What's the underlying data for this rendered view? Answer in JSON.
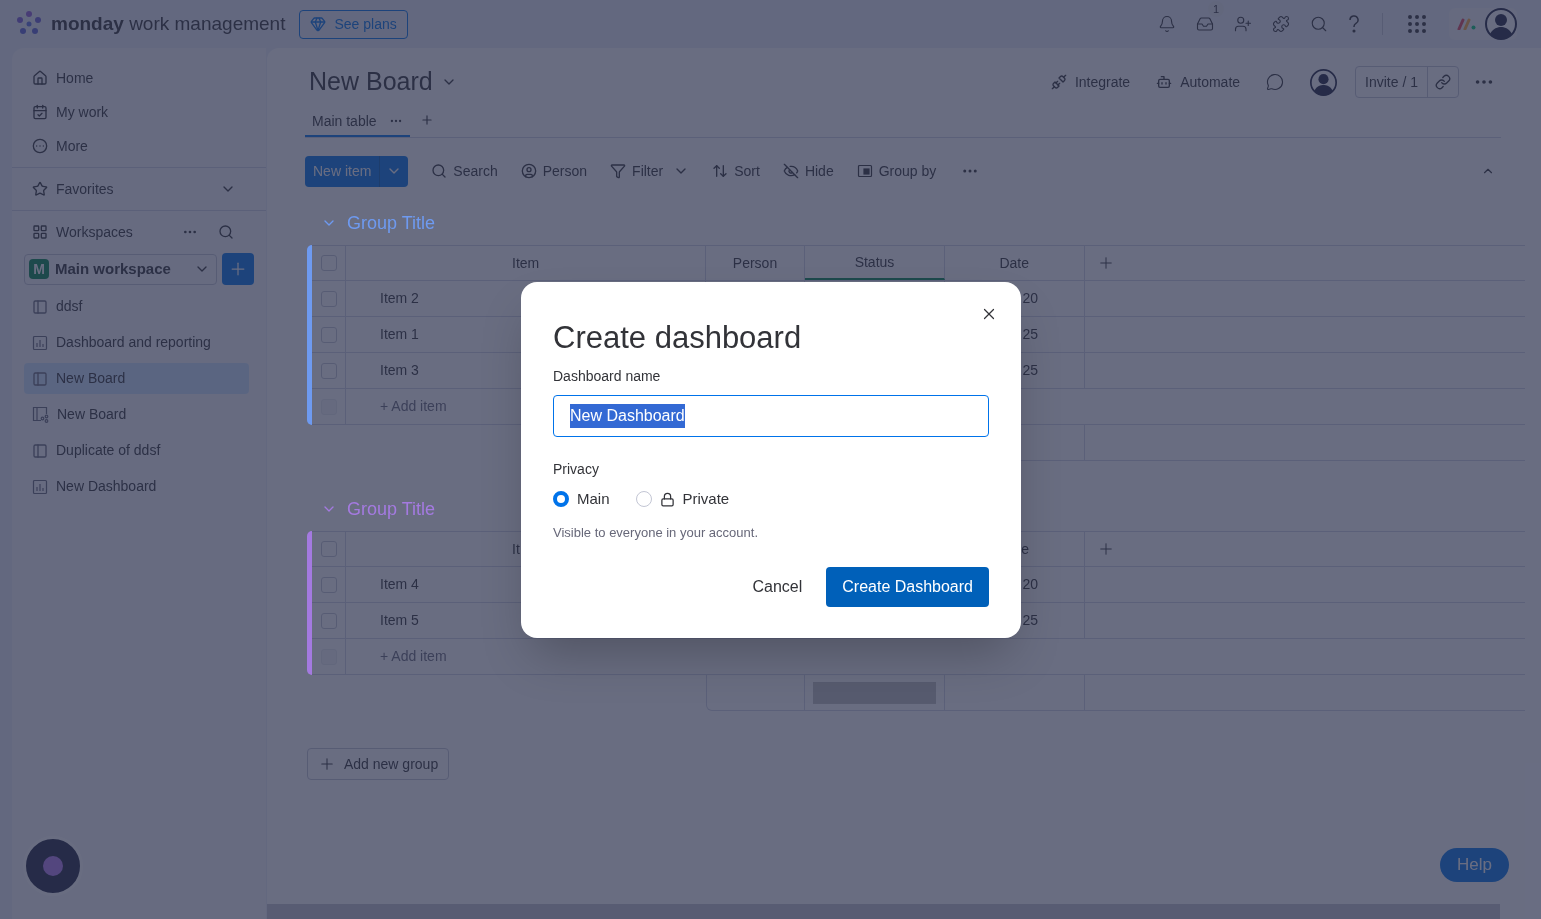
{
  "top_bar": {
    "brand": "monday",
    "product": "work management",
    "plans_button": "See plans",
    "inbox_badge": "1"
  },
  "sidebar": {
    "nav": [
      {
        "kind": "home",
        "label": "Home"
      },
      {
        "kind": "my_work",
        "label": "My work"
      },
      {
        "kind": "more",
        "label": "More"
      }
    ],
    "favorites": "Favorites",
    "workspaces_label": "Workspaces",
    "workspace": {
      "initial": "M",
      "name": "Main workspace"
    },
    "items": [
      {
        "kind": "board",
        "label": "ddsf",
        "selected": false
      },
      {
        "kind": "dashboard",
        "label": "Dashboard and reporting",
        "selected": false
      },
      {
        "kind": "board",
        "label": "New Board",
        "selected": true
      },
      {
        "kind": "shared_board",
        "label": "New Board",
        "selected": false
      },
      {
        "kind": "board",
        "label": "Duplicate of ddsf",
        "selected": false
      },
      {
        "kind": "dashboard",
        "label": "New Dashboard",
        "selected": false
      }
    ]
  },
  "board": {
    "title": "New Board",
    "header_actions": [
      {
        "kind": "integrate",
        "label": "Integrate"
      },
      {
        "kind": "automate",
        "label": "Automate"
      }
    ],
    "invite": "Invite / 1",
    "views": [
      {
        "label": "Main table",
        "selected": true
      }
    ],
    "new_item": "New item",
    "tools": [
      {
        "kind": "search",
        "label": "Search"
      },
      {
        "kind": "person",
        "label": "Person"
      },
      {
        "kind": "filter",
        "label": "Filter"
      },
      {
        "kind": "sort",
        "label": "Sort"
      },
      {
        "kind": "hide",
        "label": "Hide"
      },
      {
        "kind": "group_by",
        "label": "Group by"
      }
    ],
    "groups": [
      {
        "title": "Group Title",
        "color": "#6e9af0",
        "all_checked": false,
        "add_item_checked": false,
        "header": {
          "item": "Item",
          "person": "Person",
          "status": "Status",
          "date": "Date"
        },
        "rows": [
          {
            "item": "Item 2",
            "date": "20",
            "checked": false
          },
          {
            "item": "Item 1",
            "date": "25",
            "checked": false
          },
          {
            "item": "Item 3",
            "date": "25",
            "checked": false
          }
        ],
        "add_item": "+ Add item"
      },
      {
        "title": "Group Title",
        "color": "#a47ae0",
        "all_checked": false,
        "add_item_checked": false,
        "header": {
          "item": "It",
          "date": "e"
        },
        "rows": [
          {
            "item": "Item 4",
            "date": "20",
            "checked": false
          },
          {
            "item": "Item 5",
            "date": "25",
            "checked": false
          }
        ],
        "add_item": "+ Add item"
      }
    ],
    "add_group": "Add new group"
  },
  "dialog": {
    "title": "Create dashboard",
    "name_label": "Dashboard name",
    "name_value": "New Dashboard",
    "name_selected": true,
    "privacy_label": "Privacy",
    "privacy_options": [
      {
        "kind": "public",
        "label": "Main",
        "selected": true
      },
      {
        "kind": "private",
        "label": "Private",
        "selected": false
      }
    ],
    "privacy_hint": "Visible to everyone in your account.",
    "cancel": "Cancel",
    "confirm": "Create Dashboard"
  },
  "help_button": "Help"
}
